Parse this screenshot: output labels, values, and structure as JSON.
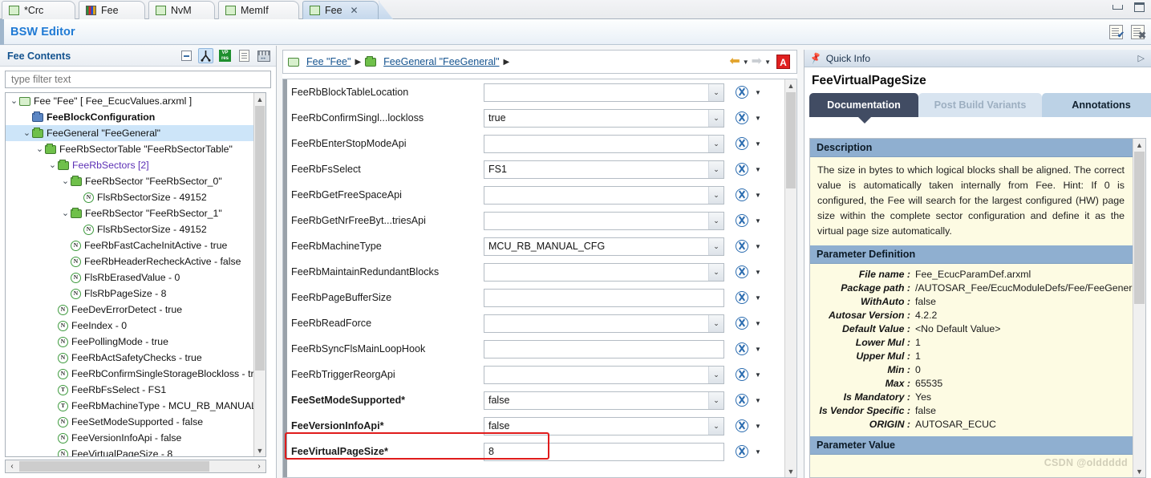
{
  "window": {
    "minimize_label": "minimize",
    "maximize_label": "maximize"
  },
  "tabs": [
    {
      "label": "*Crc",
      "icon": "file-icon",
      "active": false,
      "closable": false
    },
    {
      "label": "Fee",
      "icon": "image-icon",
      "active": false,
      "closable": false
    },
    {
      "label": "NvM",
      "icon": "file-icon",
      "active": false,
      "closable": false
    },
    {
      "label": "MemIf",
      "icon": "file-icon",
      "active": false,
      "closable": false
    },
    {
      "label": "Fee",
      "icon": "file-icon",
      "active": true,
      "closable": true,
      "close_glyph": "✕"
    }
  ],
  "editor": {
    "title": "BSW Editor",
    "tools": [
      {
        "name": "validate-icon"
      },
      {
        "name": "delete-report-icon"
      }
    ]
  },
  "left": {
    "title": "Fee Contents",
    "tools": [
      {
        "name": "collapse-all-icon"
      },
      {
        "name": "link-with-editor-icon"
      },
      {
        "name": "variant-resolve-icon",
        "text1": "VP",
        "text2": "res"
      },
      {
        "name": "show-description-icon"
      },
      {
        "name": "fit-columns-icon"
      }
    ],
    "filter_placeholder": "type filter text",
    "tree": [
      {
        "indent": 0,
        "twisty": "v",
        "icon": "file-folder",
        "label": "Fee \"Fee\" [ Fee_EcucValues.arxml ]",
        "style": "normal"
      },
      {
        "indent": 1,
        "twisty": "",
        "icon": "blue-folder",
        "label": "FeeBlockConfiguration",
        "style": "bold"
      },
      {
        "indent": 1,
        "twisty": "v",
        "icon": "green-folder",
        "label": "FeeGeneral \"FeeGeneral\"",
        "style": "selected"
      },
      {
        "indent": 2,
        "twisty": "v",
        "icon": "green-folder",
        "label": "FeeRbSectorTable \"FeeRbSectorTable\"",
        "style": "normal"
      },
      {
        "indent": 3,
        "twisty": "v",
        "icon": "green-folder",
        "label": "FeeRbSectors [2]",
        "style": "purple"
      },
      {
        "indent": 4,
        "twisty": "v",
        "icon": "green-folder",
        "label": "FeeRbSector \"FeeRbSector_0\"",
        "style": "normal"
      },
      {
        "indent": 5,
        "twisty": "",
        "icon": "attr-n",
        "label": "FlsRbSectorSize - 49152",
        "style": "normal"
      },
      {
        "indent": 4,
        "twisty": "v",
        "icon": "green-folder",
        "label": "FeeRbSector \"FeeRbSector_1\"",
        "style": "normal"
      },
      {
        "indent": 5,
        "twisty": "",
        "icon": "attr-n",
        "label": "FlsRbSectorSize - 49152",
        "style": "normal"
      },
      {
        "indent": 4,
        "twisty": "",
        "icon": "attr-n",
        "label": "FeeRbFastCacheInitActive - true",
        "style": "normal"
      },
      {
        "indent": 4,
        "twisty": "",
        "icon": "attr-n",
        "label": "FeeRbHeaderRecheckActive - false",
        "style": "normal"
      },
      {
        "indent": 4,
        "twisty": "",
        "icon": "attr-n",
        "label": "FlsRbErasedValue - 0",
        "style": "normal"
      },
      {
        "indent": 4,
        "twisty": "",
        "icon": "attr-n",
        "label": "FlsRbPageSize - 8",
        "style": "normal"
      },
      {
        "indent": 3,
        "twisty": "",
        "icon": "attr-n",
        "label": "FeeDevErrorDetect - true",
        "style": "normal"
      },
      {
        "indent": 3,
        "twisty": "",
        "icon": "attr-n",
        "label": "FeeIndex - 0",
        "style": "normal"
      },
      {
        "indent": 3,
        "twisty": "",
        "icon": "attr-n",
        "label": "FeePollingMode - true",
        "style": "normal"
      },
      {
        "indent": 3,
        "twisty": "",
        "icon": "attr-n",
        "label": "FeeRbActSafetyChecks - true",
        "style": "normal"
      },
      {
        "indent": 3,
        "twisty": "",
        "icon": "attr-n",
        "label": "FeeRbConfirmSingleStorageBlockloss - tr",
        "style": "normal"
      },
      {
        "indent": 3,
        "twisty": "",
        "icon": "attr-t",
        "label": "FeeRbFsSelect - FS1",
        "style": "normal"
      },
      {
        "indent": 3,
        "twisty": "",
        "icon": "attr-t",
        "label": "FeeRbMachineType - MCU_RB_MANUAL_",
        "style": "normal"
      },
      {
        "indent": 3,
        "twisty": "",
        "icon": "attr-n",
        "label": "FeeSetModeSupported - false",
        "style": "normal"
      },
      {
        "indent": 3,
        "twisty": "",
        "icon": "attr-n",
        "label": "FeeVersionInfoApi - false",
        "style": "normal"
      },
      {
        "indent": 3,
        "twisty": "",
        "icon": "attr-n",
        "label": "FeeVirtualPageSize - 8",
        "style": "normal"
      }
    ]
  },
  "center": {
    "breadcrumb": [
      {
        "label": "Fee \"Fee\"",
        "icon": "file-folder"
      },
      {
        "label": "FeeGeneral \"FeeGeneral\"",
        "icon": "green-folder"
      }
    ],
    "nav": {
      "back_icon": "back-arrow-icon",
      "forward_icon": "forward-arrow-icon",
      "autosar_button": "A"
    },
    "fields": [
      {
        "label": "FeeRbBlockTableLocation",
        "value": "",
        "type": "combo",
        "bold": false
      },
      {
        "label": "FeeRbConfirmSingl...lockloss",
        "value": "true",
        "type": "combo",
        "bold": false
      },
      {
        "label": "FeeRbEnterStopModeApi",
        "value": "",
        "type": "combo",
        "bold": false
      },
      {
        "label": "FeeRbFsSelect",
        "value": "FS1",
        "type": "combo",
        "bold": false
      },
      {
        "label": "FeeRbGetFreeSpaceApi",
        "value": "",
        "type": "combo",
        "bold": false
      },
      {
        "label": "FeeRbGetNrFreeByt...triesApi",
        "value": "",
        "type": "combo",
        "bold": false
      },
      {
        "label": "FeeRbMachineType",
        "value": "MCU_RB_MANUAL_CFG",
        "type": "combo",
        "bold": false
      },
      {
        "label": "FeeRbMaintainRedundantBlocks",
        "value": "",
        "type": "combo",
        "bold": false
      },
      {
        "label": "FeeRbPageBufferSize",
        "value": "",
        "type": "text",
        "bold": false
      },
      {
        "label": "FeeRbReadForce",
        "value": "",
        "type": "combo",
        "bold": false
      },
      {
        "label": "FeeRbSyncFlsMainLoopHook",
        "value": "",
        "type": "text",
        "bold": false
      },
      {
        "label": "FeeRbTriggerReorgApi",
        "value": "",
        "type": "combo",
        "bold": false
      },
      {
        "label": "FeeSetModeSupported*",
        "value": "false",
        "type": "combo",
        "bold": true
      },
      {
        "label": "FeeVersionInfoApi*",
        "value": "false",
        "type": "combo",
        "bold": true
      },
      {
        "label": "FeeVirtualPageSize*",
        "value": "8",
        "type": "text",
        "bold": true
      }
    ]
  },
  "right": {
    "panel_title": "Quick Info",
    "parameter_name": "FeeVirtualPageSize",
    "tabs": [
      {
        "label": "Documentation",
        "state": "active"
      },
      {
        "label": "Post Build Variants",
        "state": "disabled"
      },
      {
        "label": "Annotations",
        "state": "normal"
      }
    ],
    "sections": {
      "description_header": "Description",
      "description_text": "The size in bytes to which logical blocks shall be aligned. The correct value is automatically taken internally from Fee. Hint: If 0 is configured, the Fee will search for the largest configured (HW) page size within the complete sector configuration and define it as the virtual page size automatically.",
      "parameter_definition_header": "Parameter Definition",
      "parameter_value_header": "Parameter Value"
    },
    "definition": [
      {
        "key": "File name :",
        "value": "Fee_EcucParamDef.arxml"
      },
      {
        "key": "Package path :",
        "value": "/AUTOSAR_Fee/EcucModuleDefs/Fee/FeeGeneral/FeeVirtualPageSize"
      },
      {
        "key": "WithAuto :",
        "value": "false"
      },
      {
        "key": "Autosar Version :",
        "value": "4.2.2"
      },
      {
        "key": "Default Value :",
        "value": "<No Default Value>"
      },
      {
        "key": "Lower Mul :",
        "value": "1"
      },
      {
        "key": "Upper Mul :",
        "value": "1"
      },
      {
        "key": "Min :",
        "value": "0"
      },
      {
        "key": "Max :",
        "value": "65535"
      },
      {
        "key": "Is Mandatory :",
        "value": "Yes"
      },
      {
        "key": "Is Vendor Specific :",
        "value": "false"
      },
      {
        "key": "ORIGIN :",
        "value": "AUTOSAR_ECUC"
      }
    ]
  },
  "watermark": "CSDN @olddddd",
  "colors": {
    "accent_blue": "#1f7ad4",
    "selection": "#cde5f9",
    "highlight_red": "#e01b1b",
    "tab_active_dark": "#414c63",
    "section_header": "#8fafd0",
    "doc_background": "#fdfbe3"
  }
}
